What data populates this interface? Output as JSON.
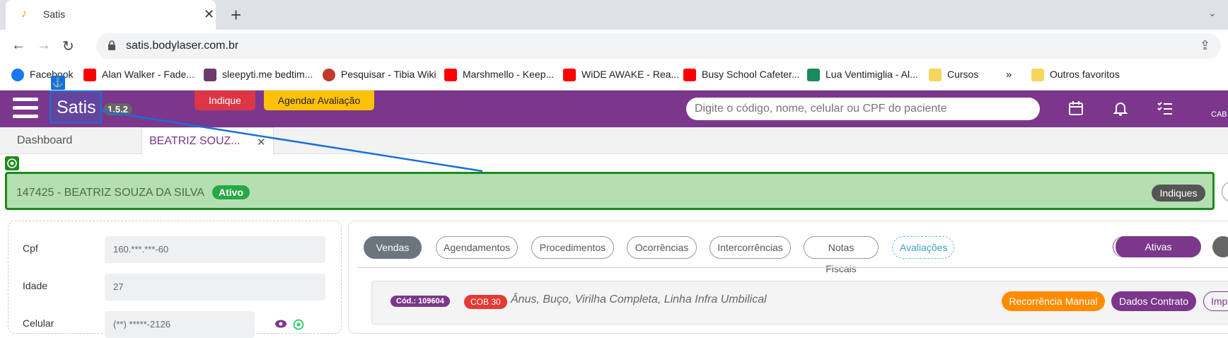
{
  "browser": {
    "tab_title": "Satis",
    "url": "satis.bodylaser.com.br",
    "bookmarks": [
      {
        "label": "Facebook",
        "color": "#1877f2"
      },
      {
        "label": "Alan Walker - Fade...",
        "color": "#ff0000"
      },
      {
        "label": "sleepyti.me bedtim...",
        "color": "#6b3b6b"
      },
      {
        "label": "Pesquisar - Tibia Wiki",
        "color": "#c0392b"
      },
      {
        "label": "Marshmello - Keep...",
        "color": "#ff0000"
      },
      {
        "label": "WiDE AWAKE - Rea...",
        "color": "#ff0000"
      },
      {
        "label": "Busy School Cafeter...",
        "color": "#ff0000"
      },
      {
        "label": "Lua Ventimiglia - Al...",
        "color": "#1a8a5a"
      },
      {
        "label": "Cursos",
        "color": "#f6d55c"
      },
      {
        "label": "Outros favoritos",
        "color": "#f6d55c"
      }
    ],
    "more_bookmarks": "»"
  },
  "app": {
    "brand": "Satis",
    "version": "1.5.2",
    "indique_label": "Indique",
    "agendar_label": "Agendar Avaliação",
    "search_placeholder": "Digite o código, nome, celular ou CPF do paciente",
    "user_abbrev": "CAB",
    "accent": "#7b378b"
  },
  "page_tabs": {
    "dashboard": "Dashboard",
    "patient_tab": "BEATRIZ SOUZ..."
  },
  "patient": {
    "header": "147425 - BEATRIZ SOUZA DA SILVA",
    "status": "Ativo",
    "indiques_label": "Indiques",
    "fields": {
      "cpf_label": "Cpf",
      "cpf_value": "160.***.***-60",
      "idade_label": "Idade",
      "idade_value": "27",
      "celular_label": "Celular",
      "celular_value": "(**) *****-2126"
    }
  },
  "sales_panel": {
    "filters": [
      "Vendas",
      "Agendamentos",
      "Procedimentos",
      "Ocorrências",
      "Intercorrências",
      "Notas Fiscais",
      "Avaliações"
    ],
    "ativas_label": "Ativas",
    "sale": {
      "cod": "Cód.: 109604",
      "cob": "COB 30",
      "areas": "Ânus, Buço, Virilha Completa, Linha Infra Umbilical",
      "recorrencia_label": "Recorrência Manual",
      "dados_label": "Dados Contrato",
      "impr_label": "Impr"
    }
  }
}
